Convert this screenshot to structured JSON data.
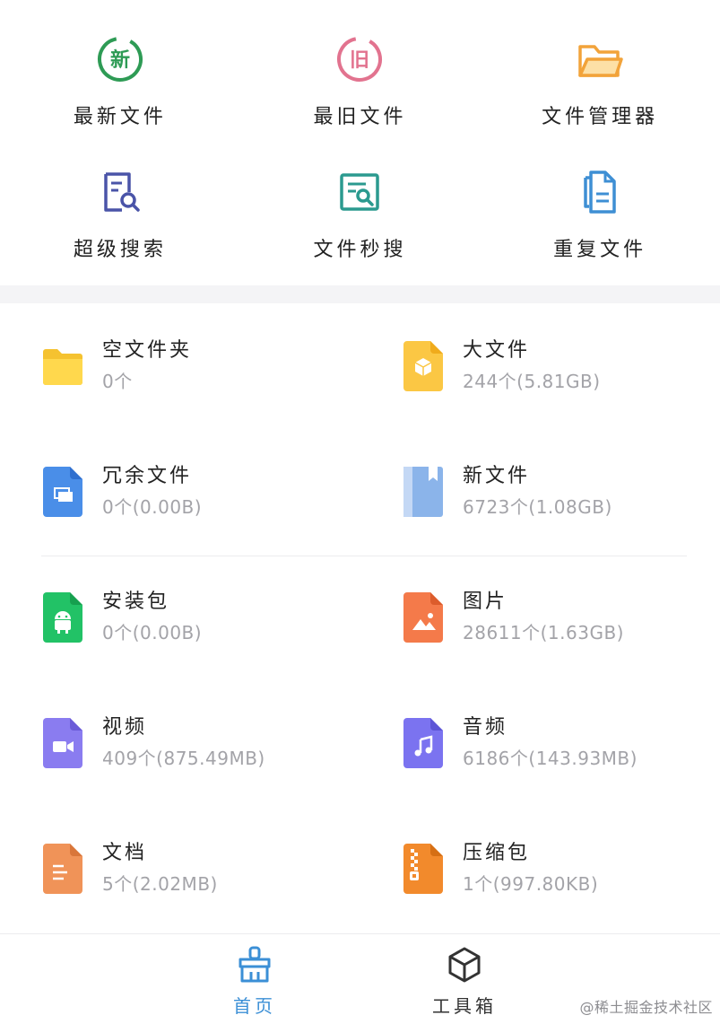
{
  "colors": {
    "accent": "#3b8fd6",
    "green": "#2e9b55",
    "pink": "#e2738f",
    "orange": "#f2a33a",
    "indigo": "#4a54a8",
    "teal": "#2b9a8f",
    "blue": "#3e8fd4"
  },
  "quick_access": [
    {
      "label": "最新文件",
      "icon": "new-badge-icon"
    },
    {
      "label": "最旧文件",
      "icon": "old-badge-icon"
    },
    {
      "label": "文件管理器",
      "icon": "folder-open-icon"
    },
    {
      "label": "超级搜索",
      "icon": "document-search-icon"
    },
    {
      "label": "文件秒搜",
      "icon": "document-scan-icon"
    },
    {
      "label": "重复文件",
      "icon": "duplicate-file-icon"
    }
  ],
  "badges": {
    "new": "新",
    "old": "旧"
  },
  "categories": [
    {
      "name": "空文件夹",
      "meta": "0个",
      "icon": "folder-icon"
    },
    {
      "name": "大文件",
      "meta": "244个(5.81GB)",
      "icon": "large-file-icon"
    },
    {
      "name": "冗余文件",
      "meta": "0个(0.00B)",
      "icon": "redundant-file-icon"
    },
    {
      "name": "新文件",
      "meta": "6723个(1.08GB)",
      "icon": "new-file-book-icon"
    },
    {
      "name": "安装包",
      "meta": "0个(0.00B)",
      "icon": "android-package-icon"
    },
    {
      "name": "图片",
      "meta": "28611个(1.63GB)",
      "icon": "image-file-icon"
    },
    {
      "name": "视频",
      "meta": "409个(875.49MB)",
      "icon": "video-file-icon"
    },
    {
      "name": "音频",
      "meta": "6186个(143.93MB)",
      "icon": "audio-file-icon"
    },
    {
      "name": "文档",
      "meta": "5个(2.02MB)",
      "icon": "document-file-icon"
    },
    {
      "name": "压缩包",
      "meta": "1个(997.80KB)",
      "icon": "zip-file-icon"
    }
  ],
  "bottom_nav": {
    "home": {
      "label": "首页",
      "icon": "broom-icon",
      "active": true
    },
    "tools": {
      "label": "工具箱",
      "icon": "cube-icon",
      "active": false
    }
  },
  "watermark": "@稀土掘金技术社区"
}
